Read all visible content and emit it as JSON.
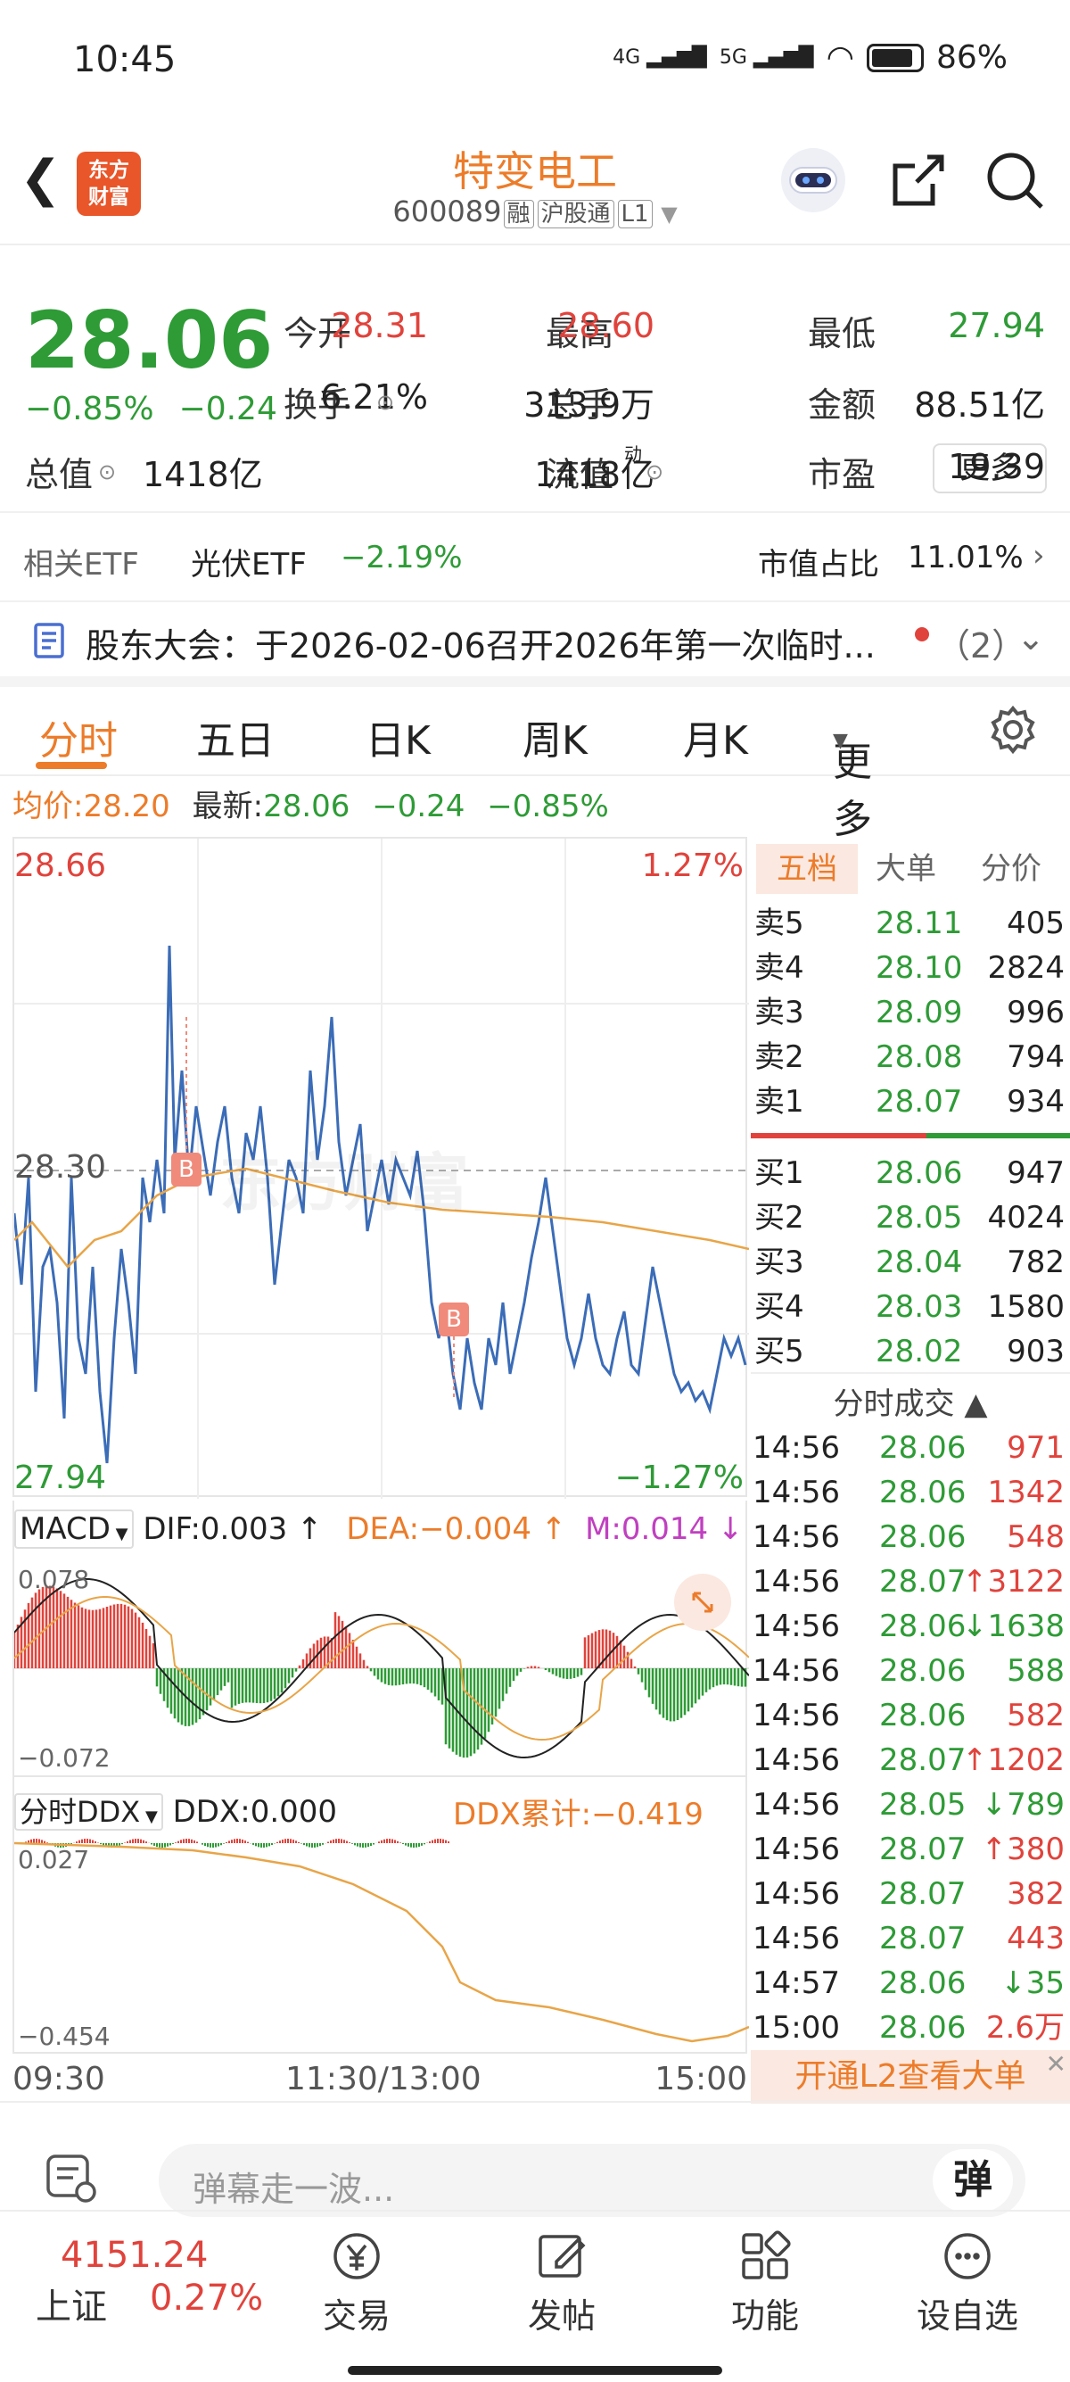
{
  "status": {
    "time": "10:45",
    "net1": "4G",
    "net2": "5G",
    "battery": "86%"
  },
  "header": {
    "logo": "东方\n财富",
    "title": "特变电工",
    "code": "600089",
    "tags": [
      "融",
      "沪股通",
      "L1"
    ]
  },
  "quote": {
    "price": "28.06",
    "pct": "−0.85%",
    "chg": "−0.24",
    "items": [
      {
        "label": "今开",
        "value": "28.31",
        "color": "red"
      },
      {
        "label": "最高",
        "value": "28.60",
        "color": "red"
      },
      {
        "label": "最低",
        "value": "27.94",
        "color": "green"
      },
      {
        "label": "换手",
        "value": "6.21%",
        "color": "dark"
      },
      {
        "label": "总手",
        "value": "313.9万",
        "color": "dark"
      },
      {
        "label": "金额",
        "value": "88.51亿",
        "color": "dark"
      },
      {
        "label": "总值",
        "value": "1418亿",
        "color": "dark"
      },
      {
        "label": "流值",
        "value": "1418亿",
        "color": "dark"
      },
      {
        "label": "市盈",
        "value": "19.39",
        "color": "dark"
      }
    ],
    "more": "更多",
    "dyn": "动"
  },
  "etf": {
    "label": "相关ETF",
    "name": "光伏ETF",
    "pct": "−2.19%",
    "ratio_label": "市值占比",
    "ratio": "11.01%"
  },
  "notice": {
    "text": "股东大会：于2026-02-06召开2026年第一次临时...",
    "count": "（2）"
  },
  "tabs": [
    "分时",
    "五日",
    "日K",
    "周K",
    "月K",
    "更多"
  ],
  "avg": {
    "avg_label": "均价:",
    "avg": "28.20",
    "last_label": "最新:",
    "last": "28.06",
    "chg": "−0.24",
    "pct": "−0.85%"
  },
  "chart": {
    "hi": "28.66",
    "lo": "27.94",
    "hi_pct": "1.27%",
    "lo_pct": "−1.27%",
    "mid": "28.30",
    "b": "B",
    "watermark": "东方财富",
    "macd": {
      "label": "MACD",
      "dif": "DIF:0.003",
      "dea": "DEA:−0.004",
      "m": "M:0.014",
      "top": "0.078",
      "bot": "−0.072"
    },
    "ddx": {
      "label": "分时DDX",
      "ddx": "DDX:0.000",
      "sum": "DDX累计:−0.419",
      "top": "0.027",
      "bot": "−0.454"
    },
    "times": [
      "09:30",
      "11:30/13:00",
      "15:00"
    ]
  },
  "panel": {
    "tabs": [
      "五档",
      "大单",
      "分价"
    ],
    "asks": [
      [
        "卖5",
        "28.11",
        "405"
      ],
      [
        "卖4",
        "28.10",
        "2824"
      ],
      [
        "卖3",
        "28.09",
        "996"
      ],
      [
        "卖2",
        "28.08",
        "794"
      ],
      [
        "卖1",
        "28.07",
        "934"
      ]
    ],
    "bids": [
      [
        "买1",
        "28.06",
        "947"
      ],
      [
        "买2",
        "28.05",
        "4024"
      ],
      [
        "买3",
        "28.04",
        "782"
      ],
      [
        "买4",
        "28.03",
        "1580"
      ],
      [
        "买5",
        "28.02",
        "903"
      ]
    ],
    "ticks_title": "分时成交",
    "ticks": [
      [
        "14:56",
        "28.06",
        "971",
        "red",
        ""
      ],
      [
        "14:56",
        "28.06",
        "1342",
        "red",
        ""
      ],
      [
        "14:56",
        "28.06",
        "548",
        "red",
        ""
      ],
      [
        "14:56",
        "28.07",
        "3122",
        "red",
        "↑"
      ],
      [
        "14:56",
        "28.06",
        "1638",
        "green",
        "↓"
      ],
      [
        "14:56",
        "28.06",
        "588",
        "green",
        ""
      ],
      [
        "14:56",
        "28.06",
        "582",
        "red",
        ""
      ],
      [
        "14:56",
        "28.07",
        "1202",
        "red",
        "↑"
      ],
      [
        "14:56",
        "28.05",
        "789",
        "green",
        "↓"
      ],
      [
        "14:56",
        "28.07",
        "380",
        "red",
        "↑"
      ],
      [
        "14:56",
        "28.07",
        "382",
        "red",
        ""
      ],
      [
        "14:56",
        "28.07",
        "443",
        "red",
        ""
      ],
      [
        "14:57",
        "28.06",
        "35",
        "green",
        "↓"
      ],
      [
        "15:00",
        "28.06",
        "2.6万",
        "red",
        ""
      ]
    ],
    "l2": "开通L2查看大单"
  },
  "footer": {
    "danmu": "弹幕走一波...",
    "danmu_btn": "弹",
    "index_value": "4151.24",
    "index_name": "上证",
    "index_pct": "0.27%",
    "nav": [
      "交易",
      "发帖",
      "功能",
      "设自选"
    ]
  }
}
